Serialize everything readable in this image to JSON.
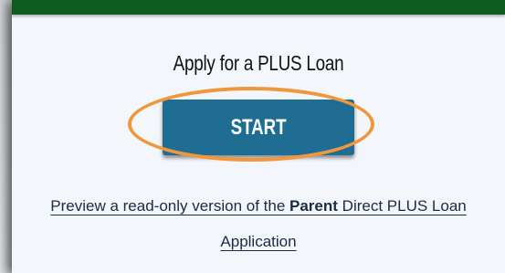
{
  "header": {
    "bar_color": "#0f5a1e"
  },
  "card": {
    "title": "Apply for a PLUS Loan",
    "start_button_label": "START",
    "start_button_color": "#1f6d92",
    "highlight_color": "#f0963c",
    "preview_link": {
      "before": "Preview a read-only version of the ",
      "bold": "Parent",
      "after_line1": " Direct PLUS Loan",
      "line2": "Application"
    }
  }
}
